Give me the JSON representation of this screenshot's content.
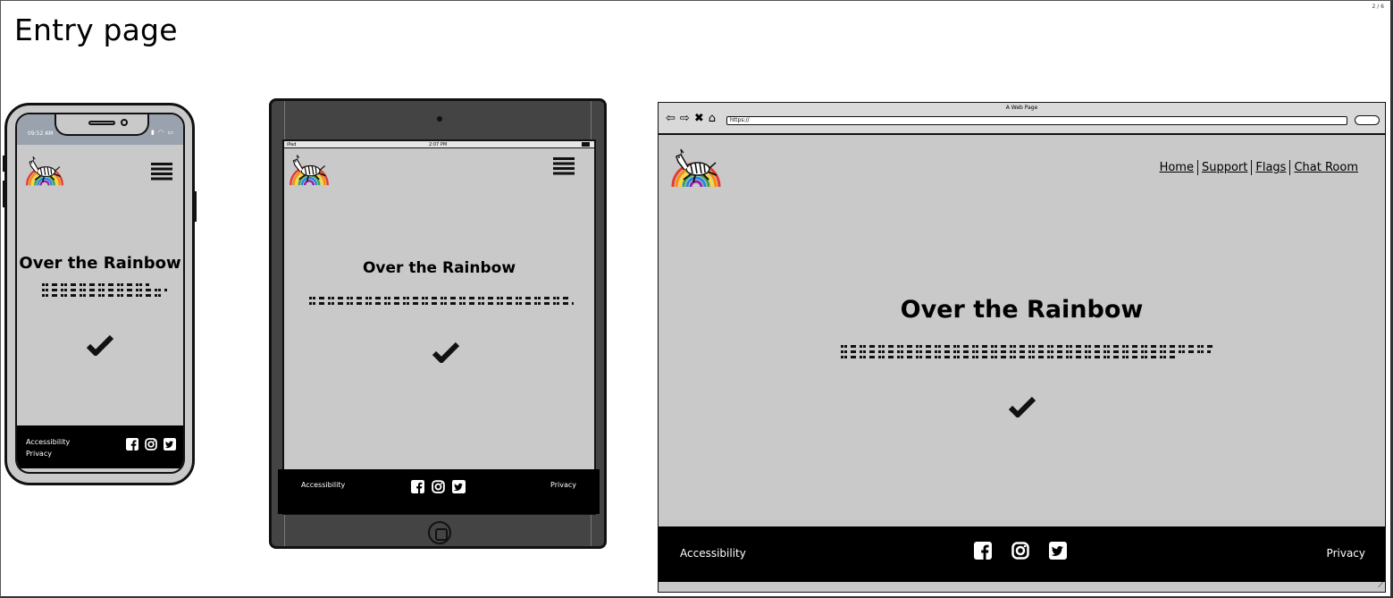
{
  "page": {
    "heading": "Entry page",
    "page_number": "2 / 6"
  },
  "phone": {
    "status_time": "09:52 AM",
    "title": "Over the Rainbow",
    "footer": {
      "accessibility": "Accessibility",
      "privacy": "Privacy"
    }
  },
  "tablet": {
    "status_left": "iPad",
    "status_time": "2:07 PM",
    "title": "Over the Rainbow",
    "footer": {
      "accessibility": "Accessibility",
      "privacy": "Privacy"
    }
  },
  "browser": {
    "window_title": "A Web Page",
    "url": "https://",
    "nav": [
      "Home",
      "Support",
      "Flags",
      "Chat Room"
    ],
    "title": "Over the Rainbow",
    "footer": {
      "accessibility": "Accessibility",
      "privacy": "Privacy"
    }
  },
  "icons": {
    "logo": "zebra-rainbow-logo",
    "menu": "hamburger-menu-icon",
    "confirm": "checkmark-icon",
    "social": [
      "facebook-icon",
      "instagram-icon",
      "twitter-icon"
    ]
  },
  "colors": {
    "content_bg": "#c9c9c9",
    "footer_bg": "#000000",
    "tablet_frame": "#444444",
    "phone_status_bar": "#9aa2ad"
  }
}
